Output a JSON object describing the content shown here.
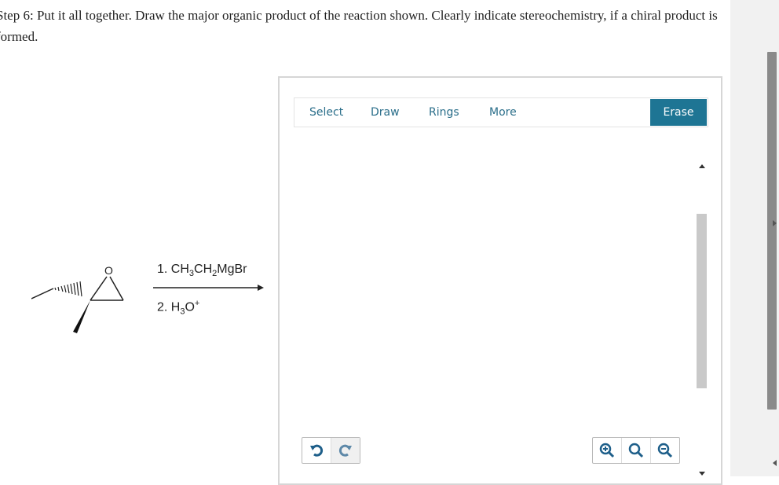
{
  "question": {
    "text": "Step 6: Put it all together. Draw the major organic product of the reaction shown. Clearly indicate stereochemistry, if a chiral product is formed."
  },
  "reaction": {
    "atom_label": "O",
    "step1_prefix": "1. CH",
    "step1_sub1": "3",
    "step1_mid": "CH",
    "step1_sub2": "2",
    "step1_suffix": "MgBr",
    "step2_prefix": "2. H",
    "step2_sub": "3",
    "step2_mid": "O",
    "step2_sup": "+"
  },
  "editor": {
    "tabs": [
      "Select",
      "Draw",
      "Rings",
      "More"
    ],
    "erase_label": "Erase"
  },
  "icons": {
    "undo": "undo-icon",
    "redo": "redo-icon",
    "zoom_in": "zoom-in-icon",
    "reset_zoom": "reset-zoom-icon",
    "zoom_out": "zoom-out-icon"
  },
  "colors": {
    "accent": "#1e7594",
    "tab_text": "#2a6e8a",
    "icon": "#1e5f8a"
  }
}
